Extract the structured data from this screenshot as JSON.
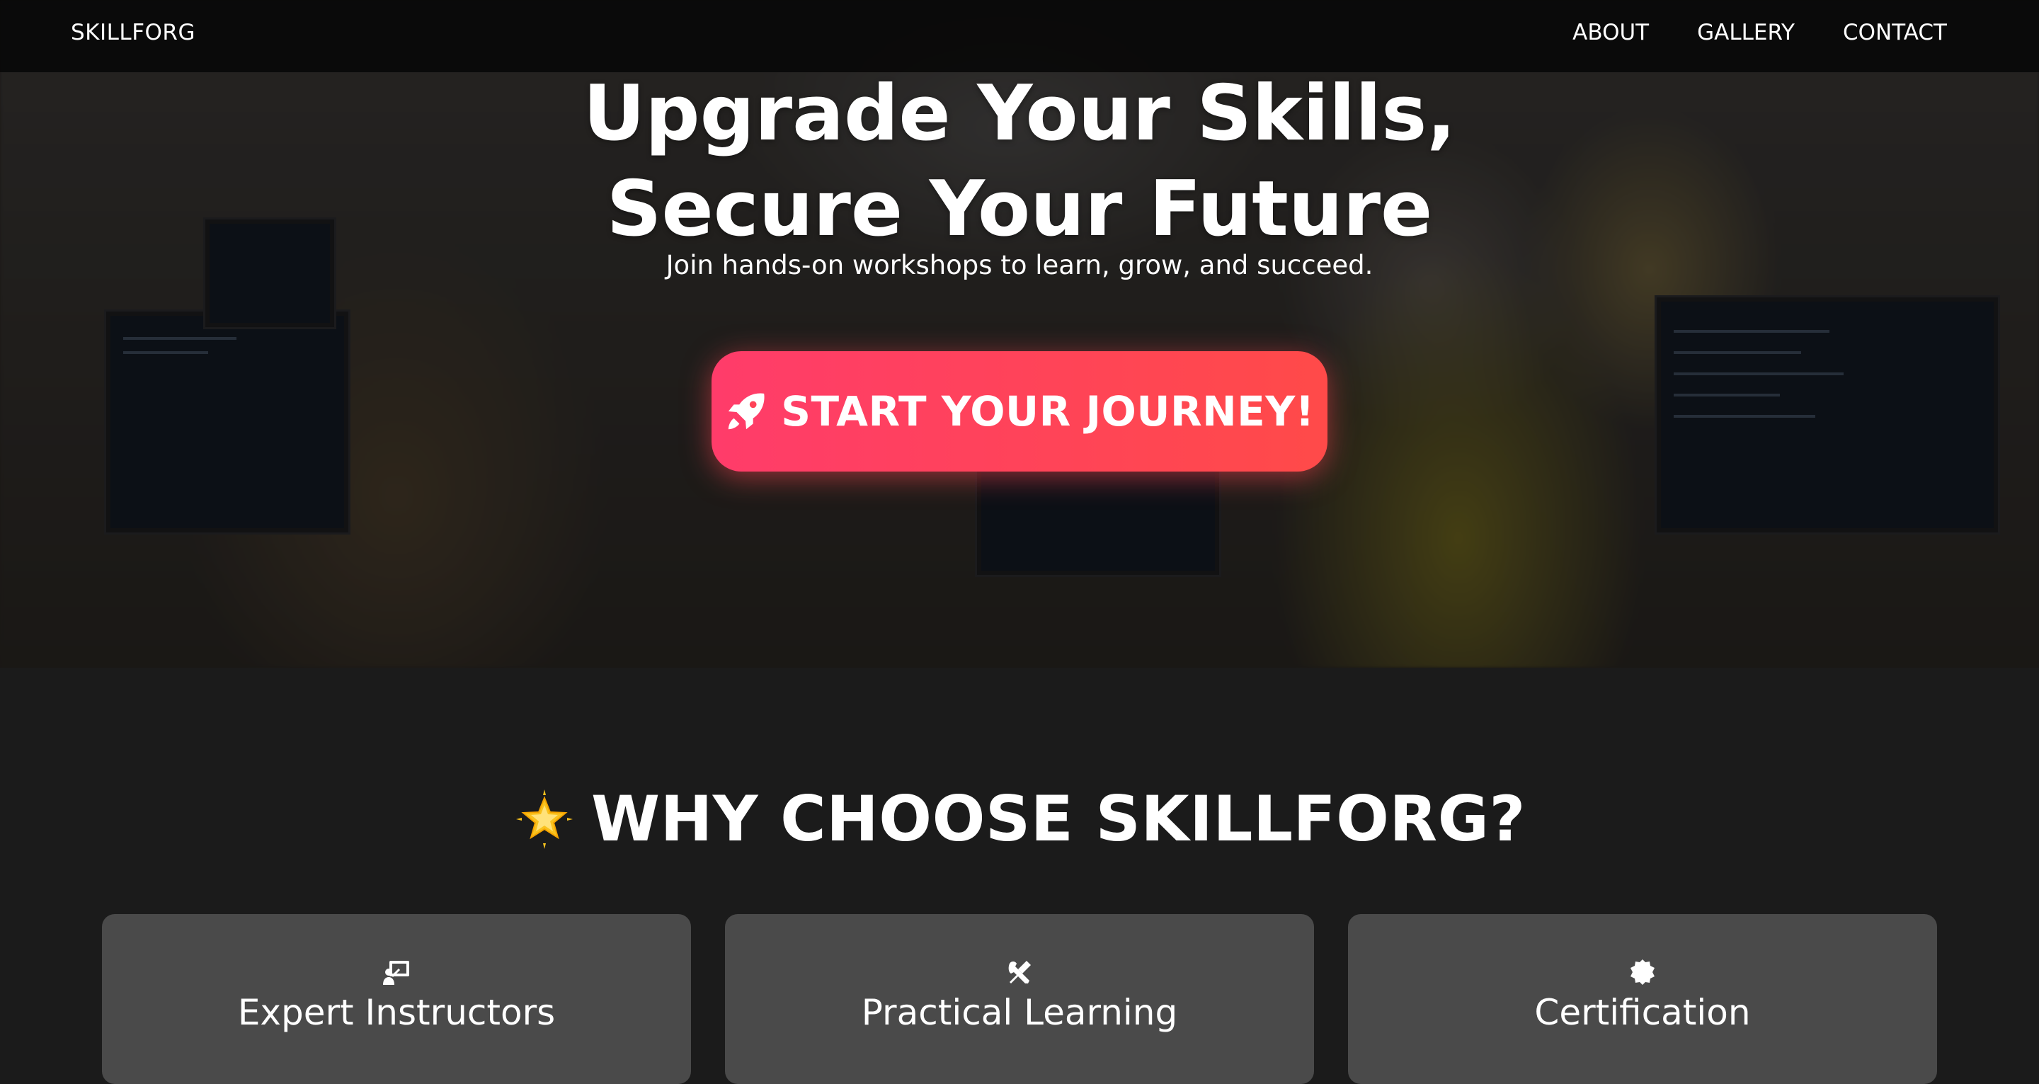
{
  "nav": {
    "brand": "SKILLFORG",
    "links": [
      "ABOUT",
      "GALLERY",
      "CONTACT"
    ]
  },
  "hero": {
    "title_line1": "Upgrade Your Skills,",
    "title_line2": "Secure Your Future",
    "subtitle": "Join hands-on workshops to learn, grow, and succeed.",
    "cta_label": "START YOUR JOURNEY!",
    "cta_icon": "rocket-icon"
  },
  "features": {
    "heading": "WHY CHOOSE SKILLFORG?",
    "heading_icon": "glowing-star-icon",
    "cards": [
      {
        "icon": "teacher-board-icon",
        "title": "Expert Instructors",
        "description": ""
      },
      {
        "icon": "tools-icon",
        "title": "Practical Learning",
        "description": ""
      },
      {
        "icon": "badge-icon",
        "title": "Certification",
        "description": ""
      }
    ]
  },
  "colors": {
    "nav_bg": "#080808",
    "cta_start": "#ff3c6a",
    "cta_end": "#ff4a49",
    "section_bg": "#1b1b1b",
    "card_bg": "#4a4a4a"
  }
}
